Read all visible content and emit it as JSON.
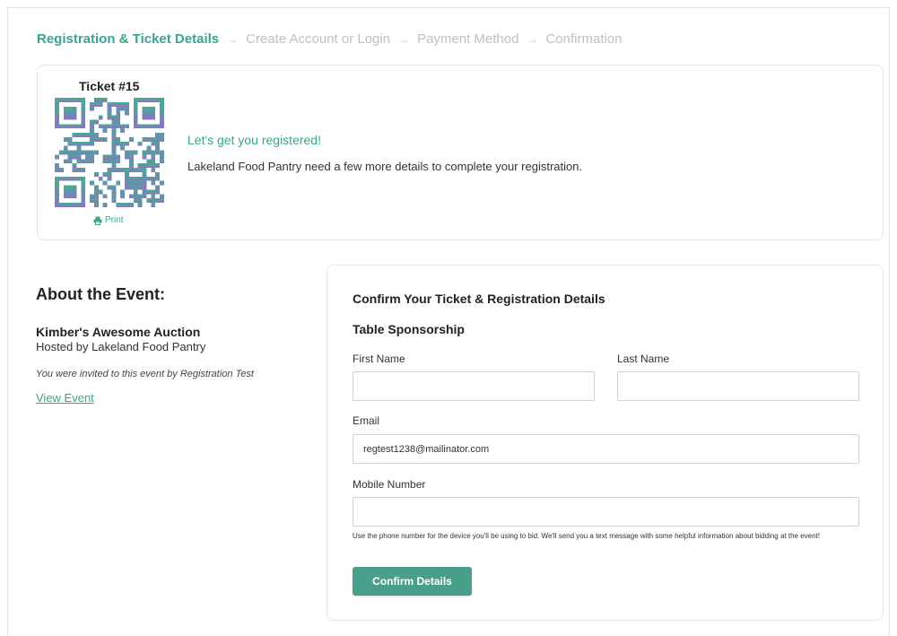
{
  "steps": [
    {
      "label": "Registration & Ticket Details",
      "active": true
    },
    {
      "label": "Create Account or Login",
      "active": false
    },
    {
      "label": "Payment Method",
      "active": false
    },
    {
      "label": "Confirmation",
      "active": false
    }
  ],
  "ticket": {
    "number_label": "Ticket #15",
    "print_label": "Print",
    "qr_icon": "qr-code-icon",
    "colors": {
      "qr_top": "#3fb18e",
      "qr_bottom": "#8f72c6"
    }
  },
  "intro": {
    "title": "Let's get you registered!",
    "subtitle": "Lakeland Food Pantry need a few more details to complete your registration."
  },
  "about": {
    "heading": "About the Event:",
    "event_name": "Kimber's Awesome Auction",
    "host": "Hosted by Lakeland Food Pantry",
    "invited": "You were invited to this event by Registration Test",
    "view_event_label": "View Event"
  },
  "form": {
    "title": "Confirm Your Ticket & Registration Details",
    "section": "Table Sponsorship",
    "first_name": {
      "label": "First Name",
      "value": ""
    },
    "last_name": {
      "label": "Last Name",
      "value": ""
    },
    "email": {
      "label": "Email",
      "value": "regtest1238@mailinator.com"
    },
    "mobile": {
      "label": "Mobile Number",
      "value": ""
    },
    "help_text": "Use the phone number for the device you'll be using to bid. We'll send you a text message with some helpful information about bidding at the event!",
    "submit_label": "Confirm Details"
  },
  "colors": {
    "accent": "#3aa58d",
    "button": "#48a08a",
    "muted_step": "#b9c3c0"
  }
}
